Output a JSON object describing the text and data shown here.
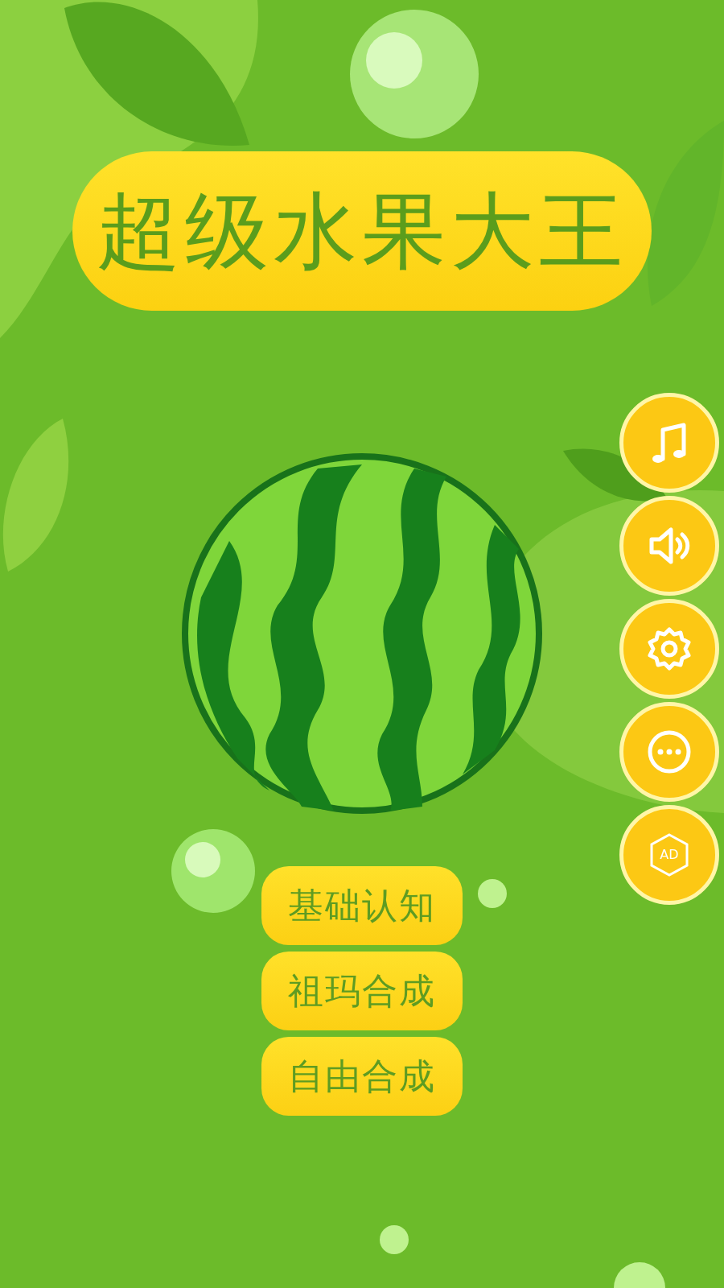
{
  "title": "超级水果大王",
  "side_buttons": [
    {
      "kind": "music"
    },
    {
      "kind": "sound"
    },
    {
      "kind": "settings"
    },
    {
      "kind": "more"
    },
    {
      "kind": "ad",
      "label": "AD"
    }
  ],
  "menu": [
    {
      "label": "基础认知"
    },
    {
      "label": "祖玛合成"
    },
    {
      "label": "自由合成"
    }
  ]
}
